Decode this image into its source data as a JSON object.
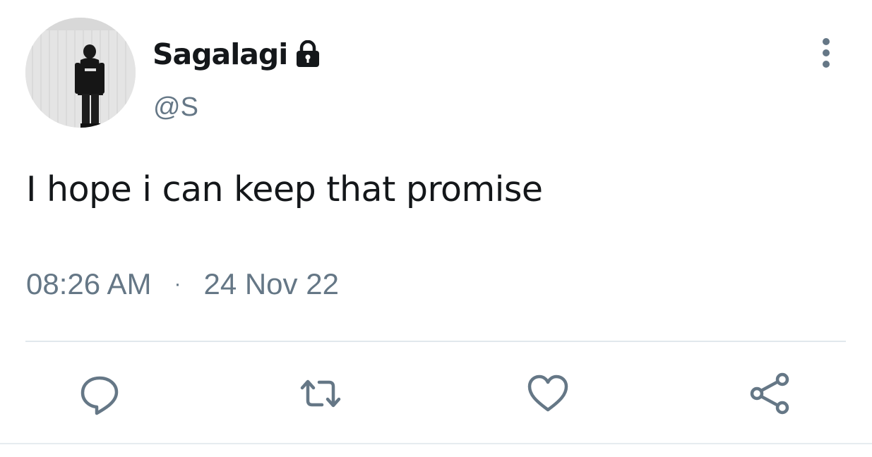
{
  "author": {
    "display_name": "Sagalagi",
    "handle": "@S",
    "protected": true,
    "avatar": "profile-photo-person-in-hoodie"
  },
  "tweet": {
    "text": "I hope i can keep that promise",
    "time": "08:26 AM",
    "separator": "·",
    "date": "24 Nov 22"
  },
  "actions": {
    "reply": "reply-icon",
    "retweet": "retweet-icon",
    "like": "heart-icon",
    "share": "share-icon"
  },
  "colors": {
    "text_primary": "#14171a",
    "text_secondary": "#657786",
    "icon": "#657786",
    "divider": "#e1e8ed",
    "background": "#ffffff"
  }
}
